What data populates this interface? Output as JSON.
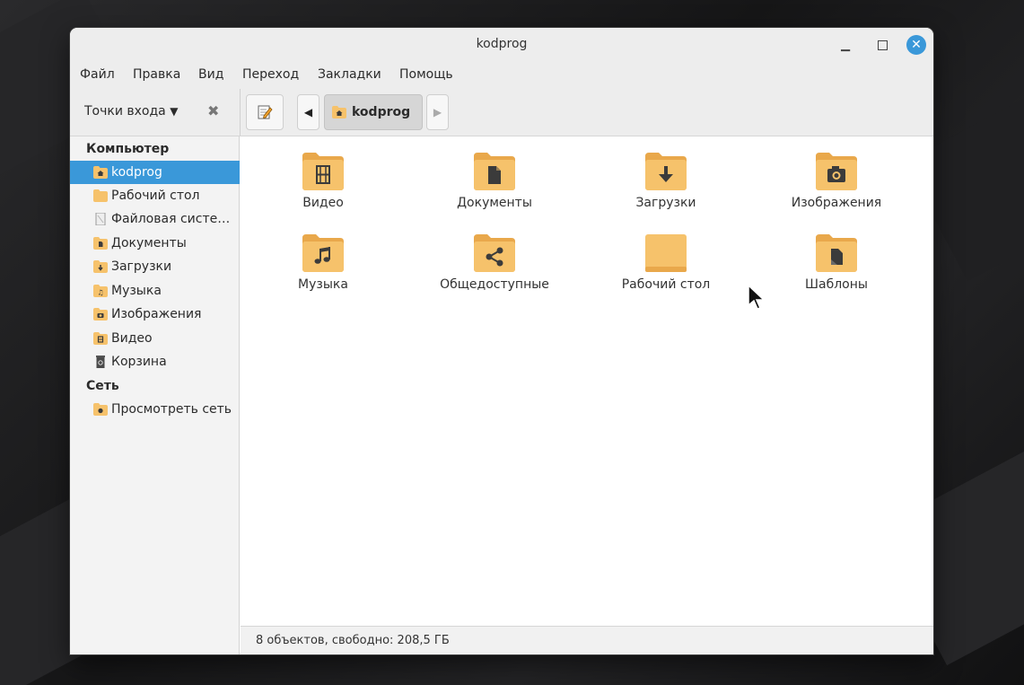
{
  "window": {
    "title": "kodprog"
  },
  "menu": [
    "Файл",
    "Правка",
    "Вид",
    "Переход",
    "Закладки",
    "Помощь"
  ],
  "toolbar": {
    "places_label": "Точки входа",
    "location_label": "kodprog"
  },
  "sidebar": {
    "computer_header": "Компьютер",
    "network_header": "Сеть",
    "items": [
      {
        "label": "kodprog",
        "icon": "home-folder-icon"
      },
      {
        "label": "Рабочий стол",
        "icon": "desktop-folder-icon"
      },
      {
        "label": "Файловая систе…",
        "icon": "drive-icon"
      },
      {
        "label": "Документы",
        "icon": "documents-folder-icon"
      },
      {
        "label": "Загрузки",
        "icon": "downloads-folder-icon"
      },
      {
        "label": "Музыка",
        "icon": "music-folder-icon"
      },
      {
        "label": "Изображения",
        "icon": "pictures-folder-icon"
      },
      {
        "label": "Видео",
        "icon": "videos-folder-icon"
      },
      {
        "label": "Корзина",
        "icon": "trash-icon"
      }
    ],
    "network_items": [
      {
        "label": "Просмотреть сеть",
        "icon": "network-icon"
      }
    ]
  },
  "files": [
    {
      "name": "Видео",
      "icon": "videos-folder-icon"
    },
    {
      "name": "Документы",
      "icon": "documents-folder-icon"
    },
    {
      "name": "Загрузки",
      "icon": "downloads-folder-icon"
    },
    {
      "name": "Изображения",
      "icon": "pictures-folder-icon"
    },
    {
      "name": "Музыка",
      "icon": "music-folder-icon"
    },
    {
      "name": "Общедоступные",
      "icon": "public-folder-icon"
    },
    {
      "name": "Рабочий стол",
      "icon": "desktop-folder-icon"
    },
    {
      "name": "Шаблоны",
      "icon": "templates-folder-icon"
    }
  ],
  "status": "8 объектов, свободно: 208,5 ГБ",
  "colors": {
    "accent": "#3a98d9",
    "folder": "#f6c26b",
    "folder_dark": "#e9a84b",
    "folder_glyph": "#3b3b3b"
  }
}
